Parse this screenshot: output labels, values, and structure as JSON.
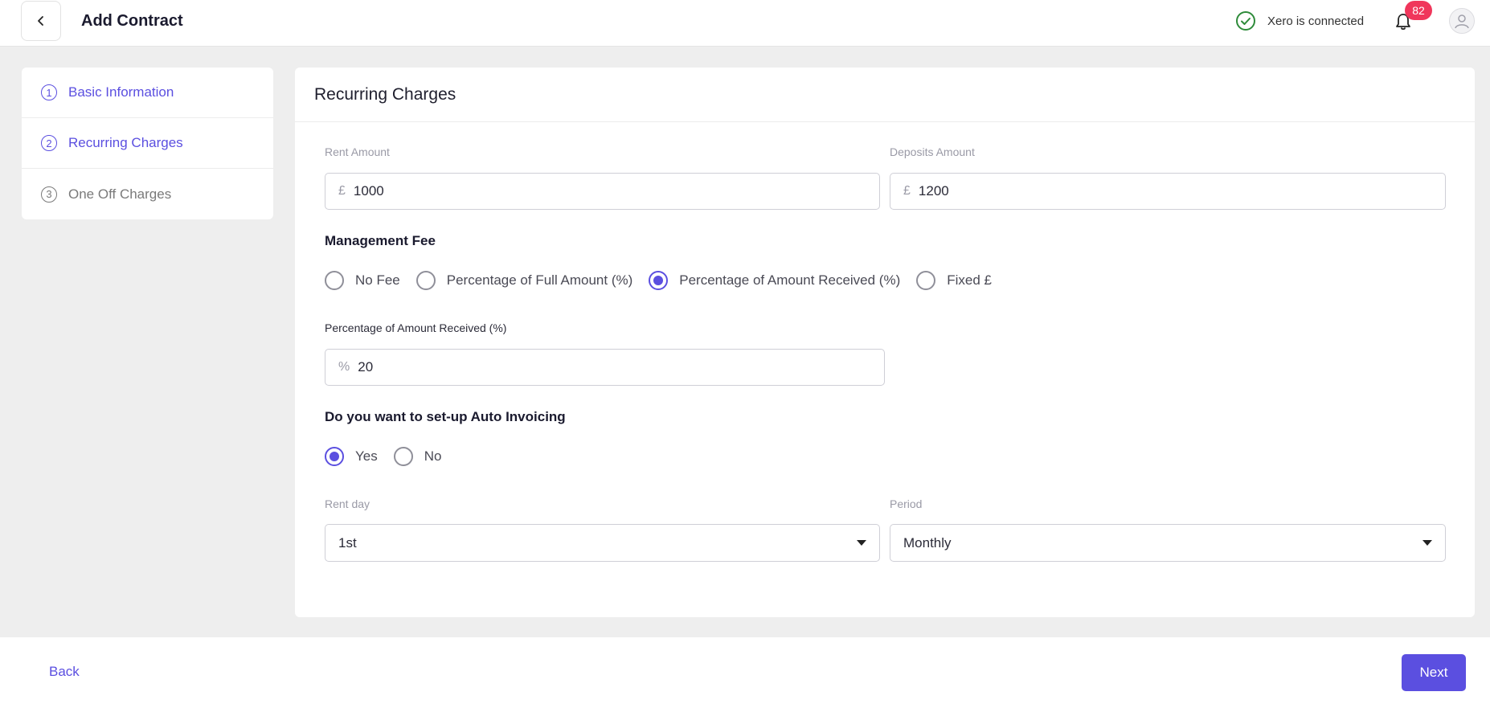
{
  "header": {
    "title": "Add Contract",
    "xero_status": "Xero is connected",
    "notification_count": "82"
  },
  "steps": [
    {
      "num": "1",
      "label": "Basic Information",
      "state": "done"
    },
    {
      "num": "2",
      "label": "Recurring Charges",
      "state": "active"
    },
    {
      "num": "3",
      "label": "One Off Charges",
      "state": "pending"
    }
  ],
  "main": {
    "title": "Recurring Charges",
    "rent_amount": {
      "label": "Rent Amount",
      "prefix": "£",
      "value": "1000"
    },
    "deposits_amount": {
      "label": "Deposits Amount",
      "prefix": "£",
      "value": "1200"
    },
    "management_fee": {
      "title": "Management Fee",
      "options": [
        "No Fee",
        "Percentage of Full Amount (%)",
        "Percentage of Amount Received (%)",
        "Fixed £"
      ],
      "selected": "Percentage of Amount Received (%)"
    },
    "percentage_field": {
      "label": "Percentage of Amount Received (%)",
      "prefix": "%",
      "value": "20"
    },
    "auto_invoicing": {
      "title": "Do you want to set-up Auto Invoicing",
      "options": [
        "Yes",
        "No"
      ],
      "selected": "Yes"
    },
    "rent_day": {
      "label": "Rent day",
      "value": "1st"
    },
    "period": {
      "label": "Period",
      "value": "Monthly"
    }
  },
  "footer": {
    "back_label": "Back",
    "next_label": "Next"
  },
  "colors": {
    "accent": "#5b4fe0",
    "badge": "#f0365b",
    "success": "#2e8b3a"
  }
}
